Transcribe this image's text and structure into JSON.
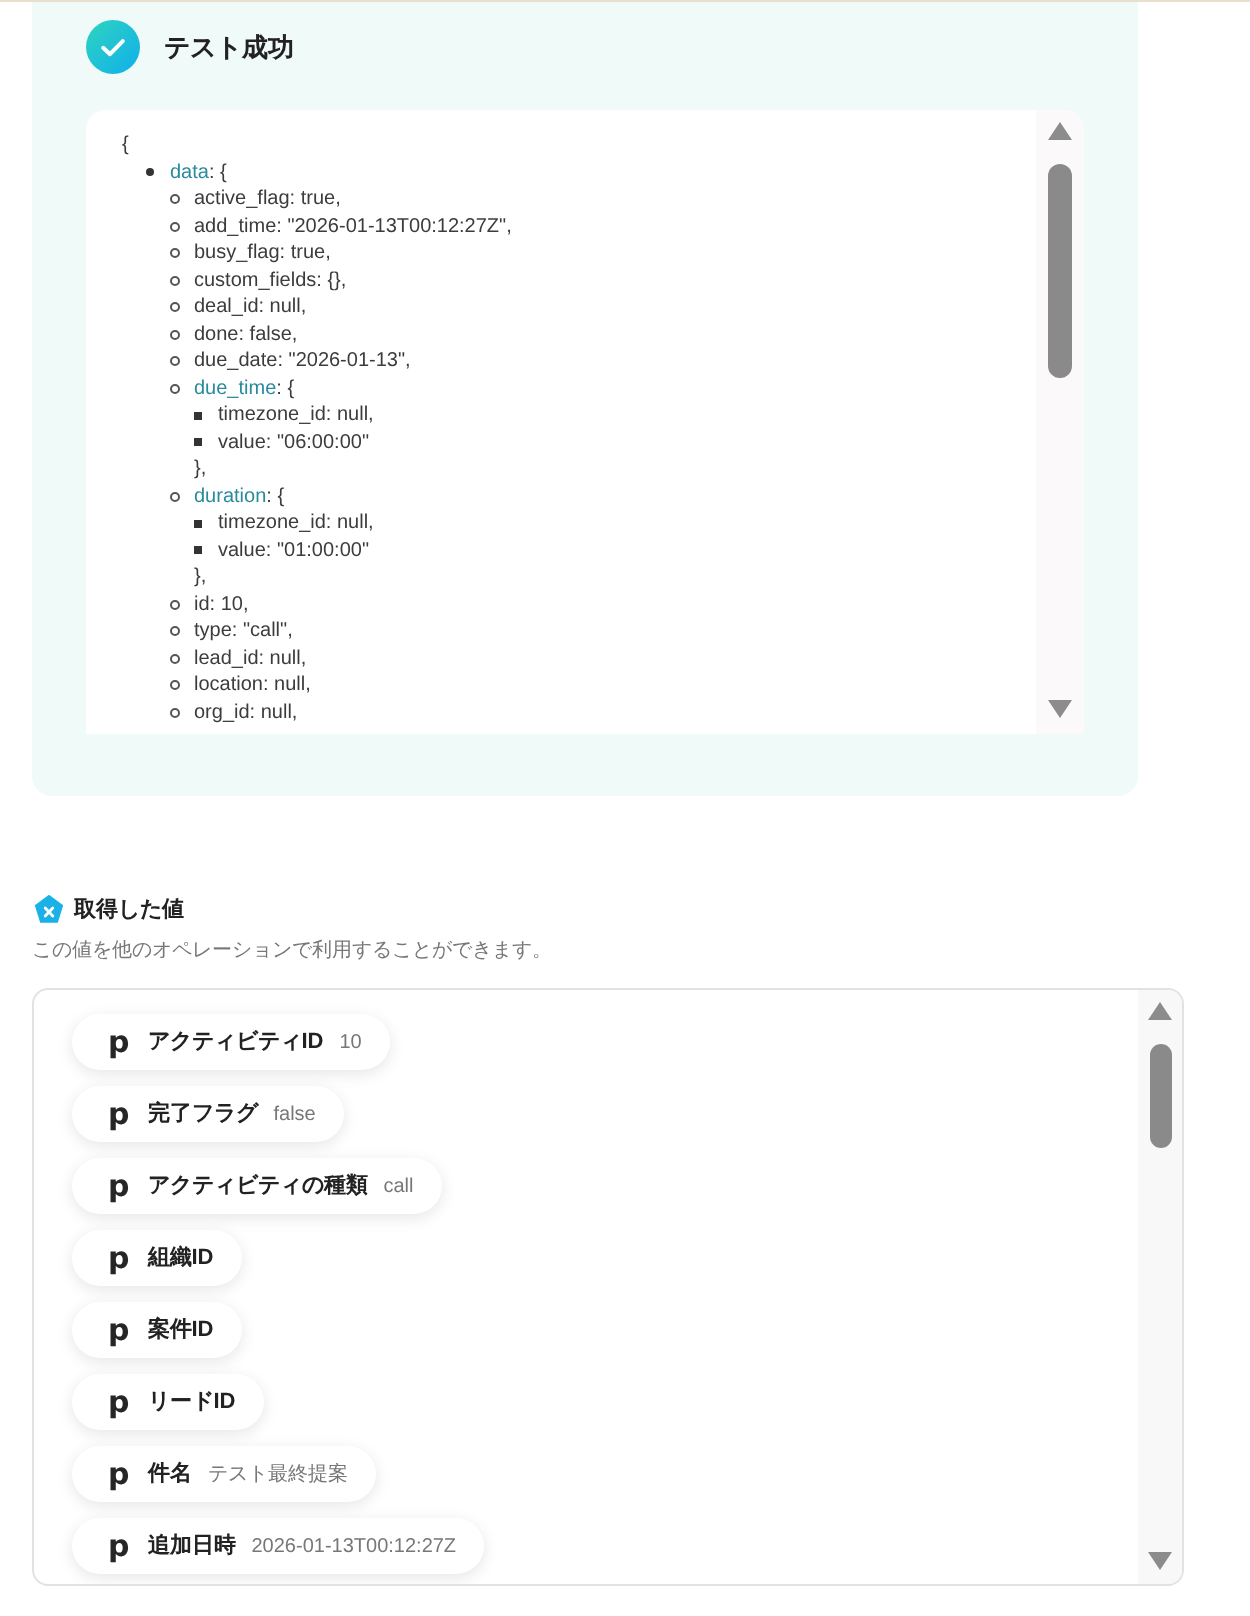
{
  "test_result": {
    "title": "テスト成功",
    "response": {
      "opening": "{",
      "items": [
        {
          "key": "data",
          "text": ": {",
          "children": [
            {
              "text": "active_flag: true,"
            },
            {
              "text": "add_time: \"2026-01-13T00:12:27Z\","
            },
            {
              "text": "busy_flag: true,"
            },
            {
              "text": "custom_fields: {},"
            },
            {
              "text": "deal_id: null,"
            },
            {
              "text": "done: false,"
            },
            {
              "text": "due_date: \"2026-01-13\","
            },
            {
              "key": "due_time",
              "text": ": {",
              "children": [
                {
                  "text": "timezone_id: null,"
                },
                {
                  "text": "value: \"06:00:00\""
                }
              ],
              "closing": "},"
            },
            {
              "key": "duration",
              "text": ": {",
              "children": [
                {
                  "text": "timezone_id: null,"
                },
                {
                  "text": "value: \"01:00:00\""
                }
              ],
              "closing": "},"
            },
            {
              "text": "id: 10,"
            },
            {
              "text": "type: \"call\","
            },
            {
              "text": "lead_id: null,"
            },
            {
              "text": "location: null,"
            },
            {
              "text": "org_id: null,"
            }
          ]
        }
      ]
    }
  },
  "output_values": {
    "title": "取得した値",
    "description": "この値を他のオペレーションで利用することができます。",
    "items": [
      {
        "logo": "p",
        "label": "アクティビティID",
        "value": "10"
      },
      {
        "logo": "p",
        "label": "完了フラグ",
        "value": "false"
      },
      {
        "logo": "p",
        "label": "アクティビティの種類",
        "value": "call"
      },
      {
        "logo": "p",
        "label": "組織ID"
      },
      {
        "logo": "p",
        "label": "案件ID"
      },
      {
        "logo": "p",
        "label": "リードID"
      },
      {
        "logo": "p",
        "label": "件名",
        "value": "テスト最終提案"
      },
      {
        "logo": "p",
        "label": "追加日時",
        "value": "2026-01-13T00:12:27Z"
      }
    ]
  }
}
